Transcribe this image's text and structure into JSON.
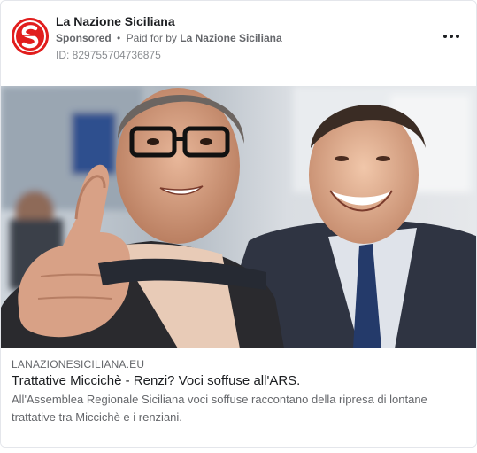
{
  "post": {
    "page_name": "La Nazione Siciliana",
    "sponsored_label": "Sponsored",
    "separator": "•",
    "paid_for_prefix": "Paid for by",
    "payer": "La Nazione Siciliana",
    "ad_id": "ID: 829755704736875",
    "avatar_icon": "la-nazione-siciliana-logo-icon",
    "more_icon": "more-options-icon"
  },
  "link_preview": {
    "domain": "LANAZIONESICILIANA.EU",
    "headline": "Trattative Miccichè - Renzi? Voci soffuse all'ARS.",
    "description": "All'Assemblea Regionale Siciliana voci soffuse raccontano della ripresa di lontane trattative tra Miccichè e i renziani."
  },
  "colors": {
    "brand_red": "#e11d1d",
    "text_primary": "#1c1e21",
    "text_secondary": "#65676b",
    "border": "#e4e6eb"
  }
}
